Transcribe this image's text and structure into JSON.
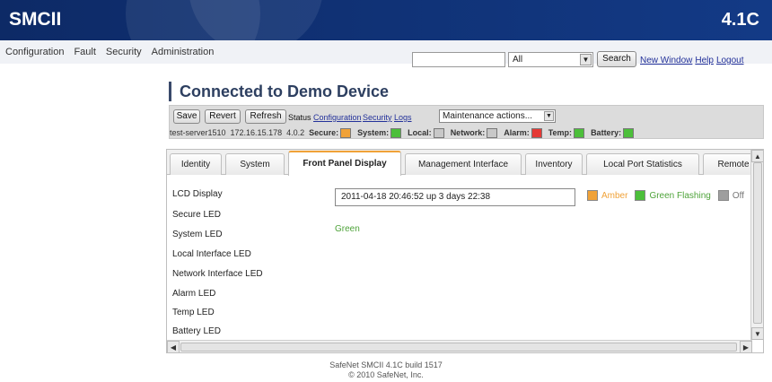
{
  "header": {
    "brand": "SMCII",
    "version": "4.1C",
    "color": "#133a86"
  },
  "menu": [
    "Configuration",
    "Fault",
    "Security",
    "Administration"
  ],
  "search": {
    "value": "",
    "scope": "All",
    "button": "Search"
  },
  "top_links": [
    "New Window",
    "Help",
    "Logout"
  ],
  "device": {
    "title": "Connected to Demo Device",
    "buttons": [
      "Save",
      "Revert",
      "Refresh"
    ],
    "status_label": "Status",
    "links": [
      "Configuration",
      "Security",
      "Logs"
    ],
    "maintenance_select": "Maintenance actions...",
    "host": "test-server1510",
    "ip": "172.16.15.178",
    "firmware": "4.0.2",
    "indicators": [
      {
        "label": "Secure:",
        "color": "#f0a238"
      },
      {
        "label": "System:",
        "color": "#4cbf3a"
      },
      {
        "label": "Local:",
        "color": "#c8c8c8"
      },
      {
        "label": "Network:",
        "color": "#c8c8c8"
      },
      {
        "label": "Alarm:",
        "color": "#e53935"
      },
      {
        "label": "Temp:",
        "color": "#4cbf3a"
      },
      {
        "label": "Battery:",
        "color": "#4cbf3a"
      }
    ]
  },
  "tabs": [
    "Identity",
    "System",
    "Front Panel Display",
    "Management Interface",
    "Inventory",
    "Local Port Statistics",
    "Remote"
  ],
  "active_tab": "Front Panel Display",
  "panel": {
    "labels": [
      "LCD Display",
      "Secure LED",
      "System LED",
      "Local Interface LED",
      "Network Interface LED",
      "Alarm LED",
      "Temp LED",
      "Battery LED"
    ],
    "lcd_value": "2011-04-18 20:46:52 up 3 days 22:38",
    "legend": [
      {
        "label": "Amber",
        "color": "#f0a238",
        "text_color": "#f0a238"
      },
      {
        "label": "Green Flashing",
        "color": "#4cbf3a",
        "text_color": "#4ea33a"
      },
      {
        "label": "Off",
        "color": "#9e9e9e",
        "text_color": "#777777"
      }
    ],
    "secure_led_state": "Green"
  },
  "footer": {
    "line1": "SafeNet SMCII 4.1C build 1517",
    "line2": "© 2010 SafeNet, Inc."
  }
}
